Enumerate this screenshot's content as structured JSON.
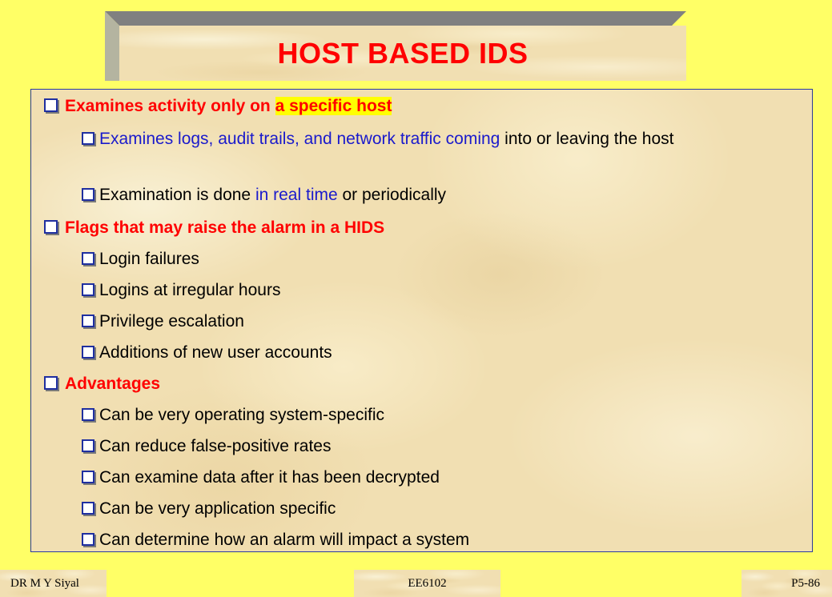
{
  "slide": {
    "title": "HOST BASED IDS",
    "bullets": [
      {
        "text": "Examines activity only on ",
        "highlight": "a specific host",
        "subs": [
          {
            "blue": "Examines logs, audit trails, and network traffic coming",
            "rest": " into or leaving the host"
          },
          {
            "pre": "Examination is done ",
            "blue": "in real time",
            "rest": " or periodically"
          }
        ]
      },
      {
        "text": "Flags that may raise the alarm in a HIDS",
        "subs": [
          "Login failures",
          "Logins at irregular hours",
          "Privilege escalation",
          "Additions of new user accounts"
        ]
      },
      {
        "text": "Advantages",
        "subs": [
          "Can be very operating system-specific",
          "Can reduce false-positive rates",
          "Can examine data after it has been decrypted",
          "Can be very application specific",
          "Can determine how an alarm will impact a system"
        ]
      }
    ]
  },
  "footer": {
    "author": "DR M Y Siyal",
    "course": "EE6102",
    "page": "P5-86"
  },
  "colors": {
    "background": "#ffff66",
    "title": "#ff0000",
    "heading": "#ff0000",
    "accent_blue": "#1a1acc",
    "highlight": "#ffff00",
    "border": "#2a3a9e"
  }
}
